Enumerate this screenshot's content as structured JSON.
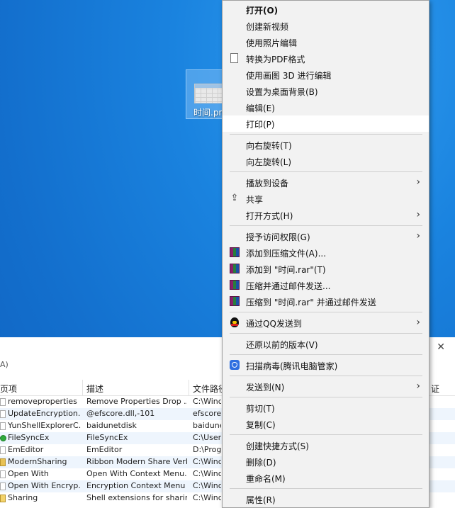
{
  "desktop": {
    "file_label": "时间.pn"
  },
  "background_window": {
    "close_glyph": "✕",
    "subtitle": "A)",
    "headers": [
      "页项",
      "描述",
      "文件路径",
      "证"
    ],
    "rows": [
      {
        "name": "removeproperties",
        "desc": "Remove Properties Drop ...",
        "path": "C:\\Wind",
        "icon": "doc"
      },
      {
        "name": "UpdateEncryption...",
        "desc": "@efscore.dll,-101",
        "path": "efscore.",
        "icon": "doc"
      },
      {
        "name": "YunShellExplorerC...",
        "desc": "baidunetdisk",
        "path": "baidune",
        "icon": "doc"
      },
      {
        "name": "FileSyncEx",
        "desc": "FileSyncEx",
        "path": "C:\\Users",
        "icon": "green"
      },
      {
        "name": "EmEditor",
        "desc": "EmEditor",
        "path": "D:\\Progr",
        "icon": "doc"
      },
      {
        "name": "ModernSharing",
        "desc": "Ribbon Modern Share Verb",
        "path": "C:\\Wind",
        "icon": "folder"
      },
      {
        "name": "Open With",
        "desc": "Open With Context Menu...",
        "path": "C:\\Wind",
        "icon": "doc"
      },
      {
        "name": "Open With Encryp...",
        "desc": "Encryption Context Menu",
        "path": "C:\\Wind",
        "icon": "doc"
      },
      {
        "name": "Sharing",
        "desc": "Shell extensions for sharing",
        "path": "C:\\Wind",
        "icon": "lock"
      }
    ]
  },
  "context_menu": {
    "items": [
      {
        "label": "打开(O)",
        "bold": true,
        "icon": null
      },
      {
        "label": "创建新视频",
        "icon": null
      },
      {
        "label": "使用照片编辑",
        "icon": null
      },
      {
        "label": "转换为PDF格式",
        "icon": "document-icon"
      },
      {
        "label": "使用画图 3D 进行编辑",
        "icon": null
      },
      {
        "label": "设置为桌面背景(B)",
        "icon": null
      },
      {
        "label": "编辑(E)",
        "icon": null
      },
      {
        "label": "打印(P)",
        "icon": null,
        "hover": true
      },
      {
        "separator": true
      },
      {
        "label": "向右旋转(T)",
        "icon": null
      },
      {
        "label": "向左旋转(L)",
        "icon": null
      },
      {
        "separator": true
      },
      {
        "label": "播放到设备",
        "icon": null,
        "submenu": true
      },
      {
        "label": "共享",
        "icon": "share-icon"
      },
      {
        "label": "打开方式(H)",
        "icon": null,
        "submenu": true
      },
      {
        "separator": true
      },
      {
        "label": "授予访问权限(G)",
        "icon": null,
        "submenu": true
      },
      {
        "label": "添加到压缩文件(A)...",
        "icon": "winrar-icon"
      },
      {
        "label": "添加到 \"时间.rar\"(T)",
        "icon": "winrar-icon"
      },
      {
        "label": "压缩并通过邮件发送...",
        "icon": "winrar-icon"
      },
      {
        "label": "压缩到 \"时间.rar\" 并通过邮件发送",
        "icon": "winrar-icon"
      },
      {
        "separator": true
      },
      {
        "label": "通过QQ发送到",
        "icon": "qq-icon",
        "submenu": true
      },
      {
        "separator": true
      },
      {
        "label": "还原以前的版本(V)",
        "icon": null
      },
      {
        "separator": true
      },
      {
        "label": "扫描病毒(腾讯电脑管家)",
        "icon": "shield-icon"
      },
      {
        "separator": true
      },
      {
        "label": "发送到(N)",
        "icon": null,
        "submenu": true
      },
      {
        "separator": true
      },
      {
        "label": "剪切(T)",
        "icon": null
      },
      {
        "label": "复制(C)",
        "icon": null
      },
      {
        "separator": true
      },
      {
        "label": "创建快捷方式(S)",
        "icon": null
      },
      {
        "label": "删除(D)",
        "icon": null
      },
      {
        "label": "重命名(M)",
        "icon": null
      },
      {
        "separator": true
      },
      {
        "label": "属性(R)",
        "icon": null
      }
    ],
    "submenu_arrow": "›"
  }
}
